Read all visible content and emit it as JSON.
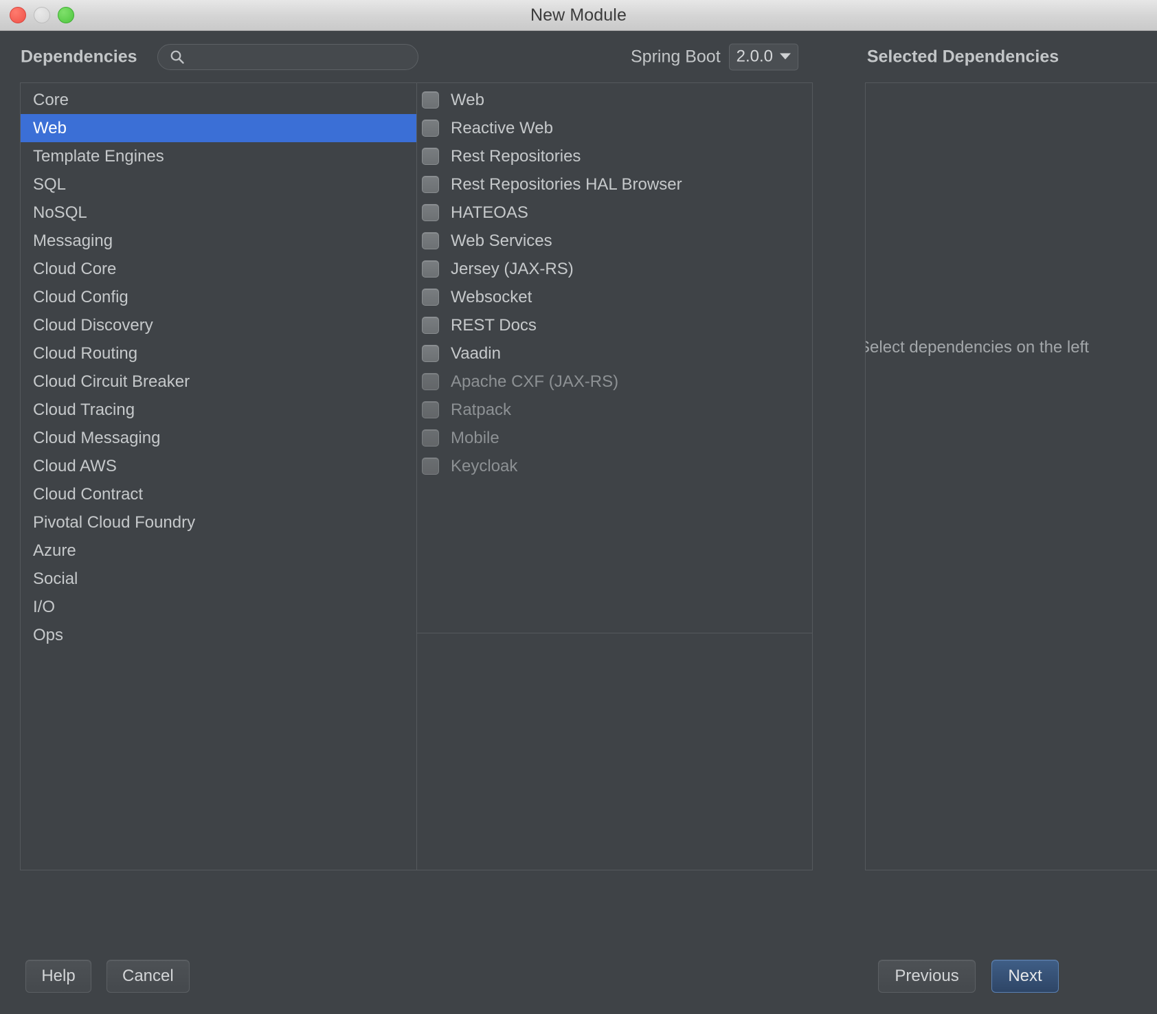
{
  "window": {
    "title": "New Module",
    "traffic_lights": [
      "close",
      "minimize",
      "zoom"
    ]
  },
  "header": {
    "dependencies_label": "Dependencies",
    "search": {
      "value": "",
      "placeholder": "",
      "icon": "search-icon"
    },
    "spring_boot_label": "Spring Boot",
    "spring_boot_version": "2.0.0",
    "selected_dependencies_label": "Selected Dependencies"
  },
  "categories": {
    "selected": "Web",
    "items": [
      {
        "label": "Core",
        "selected": false
      },
      {
        "label": "Web",
        "selected": true
      },
      {
        "label": "Template Engines",
        "selected": false
      },
      {
        "label": "SQL",
        "selected": false
      },
      {
        "label": "NoSQL",
        "selected": false
      },
      {
        "label": "Messaging",
        "selected": false
      },
      {
        "label": "Cloud Core",
        "selected": false
      },
      {
        "label": "Cloud Config",
        "selected": false
      },
      {
        "label": "Cloud Discovery",
        "selected": false
      },
      {
        "label": "Cloud Routing",
        "selected": false
      },
      {
        "label": "Cloud Circuit Breaker",
        "selected": false
      },
      {
        "label": "Cloud Tracing",
        "selected": false
      },
      {
        "label": "Cloud Messaging",
        "selected": false
      },
      {
        "label": "Cloud AWS",
        "selected": false
      },
      {
        "label": "Cloud Contract",
        "selected": false
      },
      {
        "label": "Pivotal Cloud Foundry",
        "selected": false
      },
      {
        "label": "Azure",
        "selected": false
      },
      {
        "label": "Social",
        "selected": false
      },
      {
        "label": "I/O",
        "selected": false
      },
      {
        "label": "Ops",
        "selected": false
      }
    ]
  },
  "dependencies": {
    "items": [
      {
        "label": "Web",
        "checked": false,
        "disabled": false
      },
      {
        "label": "Reactive Web",
        "checked": false,
        "disabled": false
      },
      {
        "label": "Rest Repositories",
        "checked": false,
        "disabled": false
      },
      {
        "label": "Rest Repositories HAL Browser",
        "checked": false,
        "disabled": false
      },
      {
        "label": "HATEOAS",
        "checked": false,
        "disabled": false
      },
      {
        "label": "Web Services",
        "checked": false,
        "disabled": false
      },
      {
        "label": "Jersey (JAX-RS)",
        "checked": false,
        "disabled": false
      },
      {
        "label": "Websocket",
        "checked": false,
        "disabled": false
      },
      {
        "label": "REST Docs",
        "checked": false,
        "disabled": false
      },
      {
        "label": "Vaadin",
        "checked": false,
        "disabled": false
      },
      {
        "label": "Apache CXF (JAX-RS)",
        "checked": false,
        "disabled": true
      },
      {
        "label": "Ratpack",
        "checked": false,
        "disabled": true
      },
      {
        "label": "Mobile",
        "checked": false,
        "disabled": true
      },
      {
        "label": "Keycloak",
        "checked": false,
        "disabled": true
      }
    ]
  },
  "selected_dependencies": {
    "items": [],
    "placeholder": "Select dependencies on the left"
  },
  "footer": {
    "help_label": "Help",
    "cancel_label": "Cancel",
    "previous_label": "Previous",
    "next_label": "Next"
  },
  "colors": {
    "window_background": "#3f4347",
    "panel_border": "#55595d",
    "selection_blue": "#3b6fd6",
    "default_button_blue": "#3f5e86",
    "text_primary": "#c6c9cb",
    "text_disabled": "#8d9194",
    "titlebar": "#d4d4d4"
  }
}
